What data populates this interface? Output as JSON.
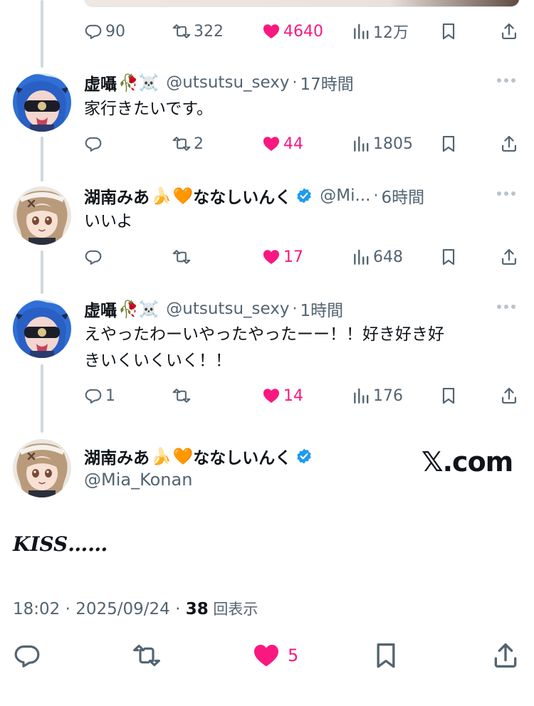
{
  "top_tweet": {
    "replies": "90",
    "reposts": "322",
    "likes": "4640",
    "views": "12万"
  },
  "replies": [
    {
      "display_name": "虚囁",
      "name_emoji": "🥀☠️",
      "handle": "@utsutsu_sexy",
      "time": "17時間",
      "text": "家行きたいです。",
      "reply_count": "",
      "repost_count": "2",
      "like_count": "44",
      "view_count": "1805",
      "verified": false
    },
    {
      "display_name": "湖南みあ",
      "name_emoji_1": "🍌",
      "name_emoji_2": "🧡",
      "name_suffix": "ななしいんく",
      "handle": "@Mi...",
      "time": "6時間",
      "text": "いいよ",
      "reply_count": "",
      "repost_count": "",
      "like_count": "17",
      "view_count": "648",
      "verified": true
    },
    {
      "display_name": "虚囁",
      "name_emoji": "🥀☠️",
      "handle": "@utsutsu_sexy",
      "time": "1時間",
      "text_line1": "えやったわーいやったやったーー！！好き好き好",
      "text_line2": "きいくいくいく！！",
      "reply_count": "1",
      "repost_count": "",
      "like_count": "14",
      "view_count": "176",
      "verified": false
    }
  ],
  "main_tweet": {
    "display_name": "湖南みあ",
    "name_emoji_1": "🍌",
    "name_emoji_2": "🧡",
    "name_suffix": "ななしいんく",
    "handle": "@Mia_Konan",
    "watermark": "𝕏.com",
    "text": "KISS……",
    "timestamp": "18:02 · 2025/09/24 · ",
    "views": "38",
    "views_label": " 回表示",
    "like_count": "5"
  },
  "colors": {
    "like_pink": "#f91880",
    "verified_blue": "#1d9bf0",
    "secondary_gray": "#536471",
    "thread_line": "#cfd9de"
  },
  "icons": [
    "reply-icon",
    "repost-icon",
    "like-icon",
    "views-icon",
    "bookmark-icon",
    "share-icon",
    "more-icon",
    "verified-icon"
  ]
}
